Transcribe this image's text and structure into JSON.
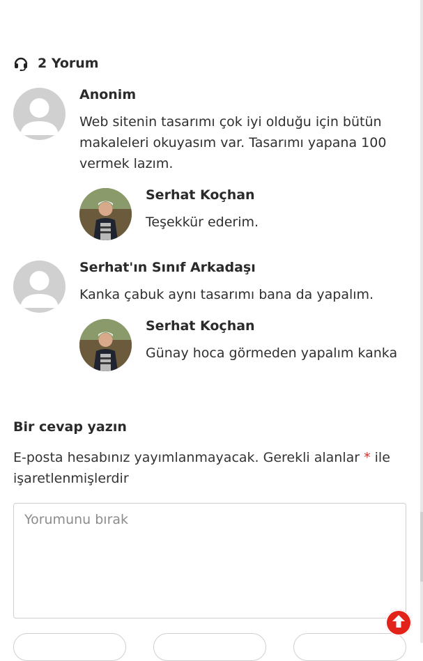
{
  "comments_header": {
    "count_label": "2 Yorum",
    "icon": "headset-icon"
  },
  "comments": [
    {
      "author": "Anonim",
      "avatar": "default-avatar",
      "text": "Web sitenin tasarımı çok iyi olduğu için bütün makaleleri okuyasım var. Tasarımı yapana 100 vermek lazım.",
      "reply": {
        "author": "Serhat Koçhan",
        "avatar": "user-photo-avatar",
        "text": "Teşekkür ederim."
      }
    },
    {
      "author": "Serhat'ın Sınıf Arkadaşı",
      "avatar": "default-avatar",
      "text": "Kanka çabuk aynı tasarımı bana da yapalım.",
      "reply": {
        "author": "Serhat Koçhan",
        "avatar": "user-photo-avatar",
        "text": "Günay hoca görmeden yapalım kanka"
      }
    }
  ],
  "reply_form": {
    "title": "Bir cevap yazın",
    "notes_before": "E-posta hesabınız yayımlanmayacak. Gerekli alanlar",
    "required_mark": "*",
    "notes_after": "ile işaretlenmişlerdir",
    "comment_placeholder": "Yorumunu bırak",
    "comment_value": ""
  },
  "scroll_top": {
    "icon": "arrow-up-icon",
    "color": "#e2231a"
  }
}
